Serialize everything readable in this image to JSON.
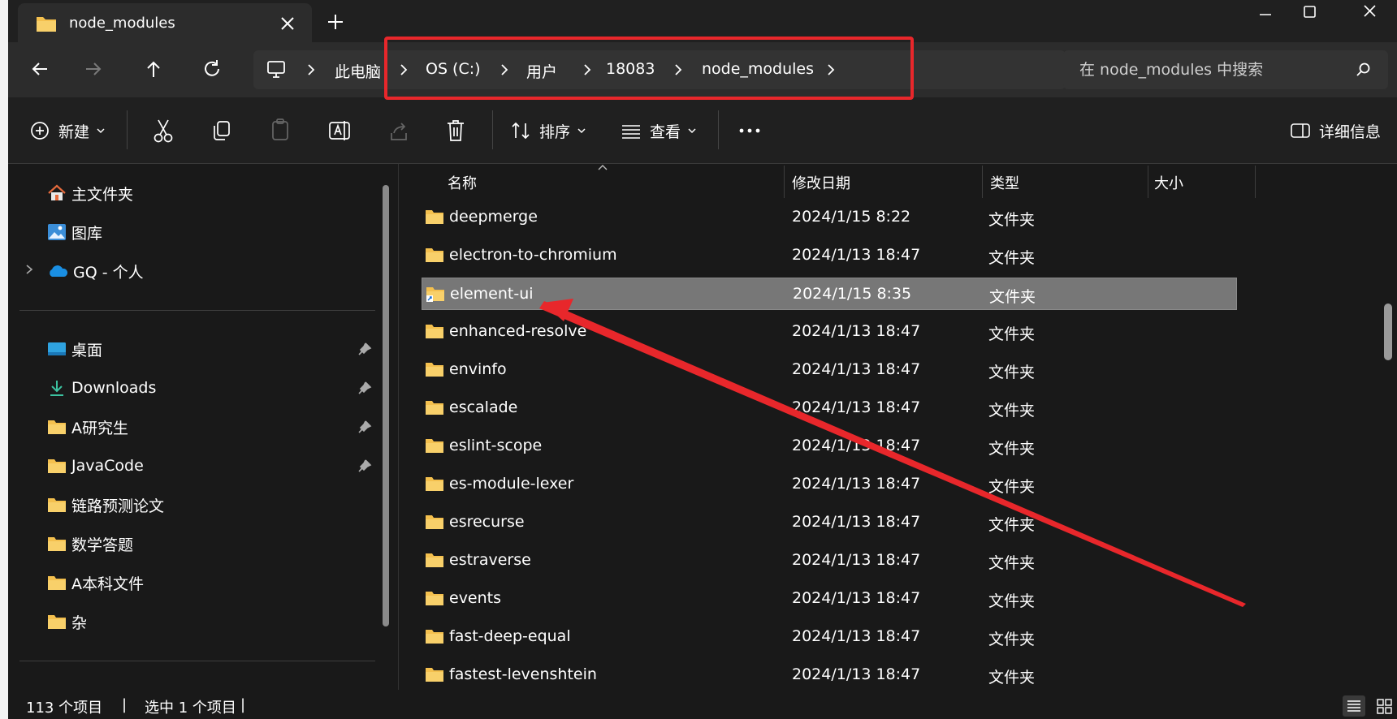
{
  "tab": {
    "title": "node_modules"
  },
  "address": {
    "crumbs": [
      "此电脑",
      "OS (C:)",
      "用户",
      "18083",
      "node_modules"
    ]
  },
  "search": {
    "placeholder": "在 node_modules 中搜索"
  },
  "toolbar": {
    "new_label": "新建",
    "sort_label": "排序",
    "view_label": "查看",
    "details_label": "详细信息"
  },
  "sidebar": {
    "items": [
      {
        "label": "主文件夹",
        "icon": "home-icon"
      },
      {
        "label": "图库",
        "icon": "gallery-icon"
      },
      {
        "label": "GQ - 个人",
        "icon": "onedrive-icon"
      }
    ],
    "pinned": [
      {
        "label": "桌面",
        "icon": "desktop-icon",
        "pinned": true
      },
      {
        "label": "Downloads",
        "icon": "download-icon",
        "pinned": true
      },
      {
        "label": "A研究生",
        "icon": "folder-icon",
        "pinned": true
      },
      {
        "label": "JavaCode",
        "icon": "folder-icon",
        "pinned": true
      },
      {
        "label": "链路预测论文",
        "icon": "folder-icon",
        "pinned": false
      },
      {
        "label": "数学答题",
        "icon": "folder-icon",
        "pinned": false
      },
      {
        "label": "A本科文件",
        "icon": "folder-icon",
        "pinned": false
      },
      {
        "label": "杂",
        "icon": "folder-icon",
        "pinned": false
      }
    ]
  },
  "columns": {
    "name": "名称",
    "modified": "修改日期",
    "type": "类型",
    "size": "大小"
  },
  "files": [
    {
      "name": "deepmerge",
      "modified": "2024/1/15 8:22",
      "type": "文件夹",
      "selected": false,
      "shortcut": false
    },
    {
      "name": "electron-to-chromium",
      "modified": "2024/1/13 18:47",
      "type": "文件夹",
      "selected": false,
      "shortcut": false
    },
    {
      "name": "element-ui",
      "modified": "2024/1/15 8:35",
      "type": "文件夹",
      "selected": true,
      "shortcut": true
    },
    {
      "name": "enhanced-resolve",
      "modified": "2024/1/13 18:47",
      "type": "文件夹",
      "selected": false,
      "shortcut": false
    },
    {
      "name": "envinfo",
      "modified": "2024/1/13 18:47",
      "type": "文件夹",
      "selected": false,
      "shortcut": false
    },
    {
      "name": "escalade",
      "modified": "2024/1/13 18:47",
      "type": "文件夹",
      "selected": false,
      "shortcut": false
    },
    {
      "name": "eslint-scope",
      "modified": "2024/1/13 18:47",
      "type": "文件夹",
      "selected": false,
      "shortcut": false
    },
    {
      "name": "es-module-lexer",
      "modified": "2024/1/13 18:47",
      "type": "文件夹",
      "selected": false,
      "shortcut": false
    },
    {
      "name": "esrecurse",
      "modified": "2024/1/13 18:47",
      "type": "文件夹",
      "selected": false,
      "shortcut": false
    },
    {
      "name": "estraverse",
      "modified": "2024/1/13 18:47",
      "type": "文件夹",
      "selected": false,
      "shortcut": false
    },
    {
      "name": "events",
      "modified": "2024/1/13 18:47",
      "type": "文件夹",
      "selected": false,
      "shortcut": false
    },
    {
      "name": "fast-deep-equal",
      "modified": "2024/1/13 18:47",
      "type": "文件夹",
      "selected": false,
      "shortcut": false
    },
    {
      "name": "fastest-levenshtein",
      "modified": "2024/1/13 18:47",
      "type": "文件夹",
      "selected": false,
      "shortcut": false
    }
  ],
  "status": {
    "count": "113 个项目",
    "selection": "选中 1 个项目"
  },
  "colors": {
    "folder": "#f4c04e",
    "annotation": "#e8272b",
    "selected_row": "#777777"
  }
}
